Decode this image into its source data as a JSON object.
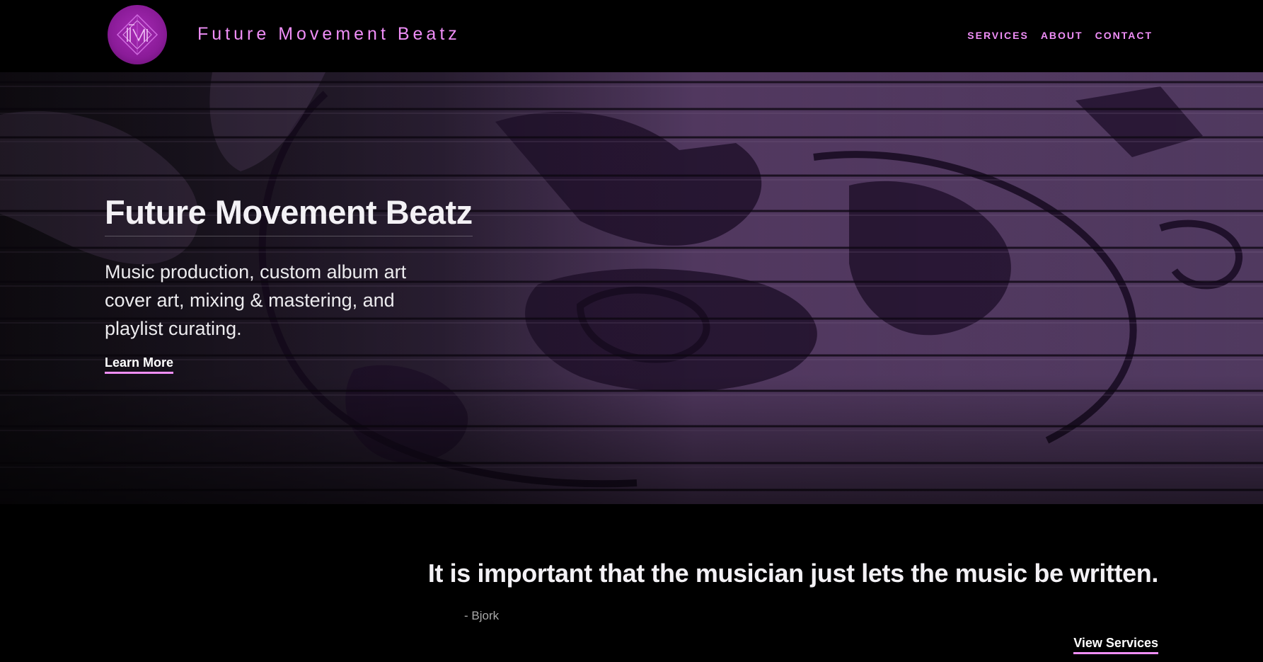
{
  "header": {
    "logo_icon": "fmb-logo-icon",
    "site_title": "Future Movement Beatz",
    "nav": [
      {
        "label": "SERVICES"
      },
      {
        "label": "ABOUT"
      },
      {
        "label": "CONTACT"
      }
    ]
  },
  "hero": {
    "title": "Future Movement Beatz",
    "description": "Music production, custom album art cover art, mixing & mastering, and playlist curating.",
    "cta_label": "Learn More"
  },
  "quote": {
    "text": "It is important that the musician just lets the music be written.",
    "author": "- Bjork",
    "cta_label": "View Services"
  },
  "colors": {
    "accent": "#ef8ef7",
    "background": "#000000",
    "hero_tint": "#6b4a7e",
    "logo": "#8a1b98"
  }
}
